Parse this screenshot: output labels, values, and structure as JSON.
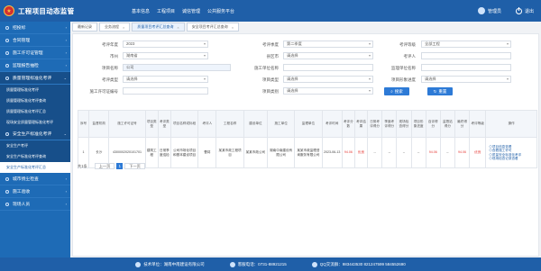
{
  "header": {
    "title": "工程项目动态监管",
    "nav": [
      "基本信息",
      "工程项目",
      "诚信管理",
      "公共服务平台"
    ],
    "user": "管理员",
    "exit": "退出"
  },
  "sidebar": {
    "items": [
      {
        "label": "招投标",
        "active": false
      },
      {
        "label": "合同管理",
        "active": false
      },
      {
        "label": "施工许可证管理",
        "active": false
      },
      {
        "label": "监理报告抽检",
        "active": false
      },
      {
        "label": "质量管理标准化考评",
        "active": false
      }
    ],
    "quality_subs": [
      "质量管理标准化考评",
      "质量管理标准化考评查询",
      "质量管理标准化考评汇总",
      "现场安全质量管理标准化考评"
    ],
    "safety_label": "安全生产标准化考评",
    "safety_subs": [
      "安全生产考评",
      "安全生产标准化考评查询",
      "安全生产标准化考评汇总"
    ],
    "bottom_items": [
      "城市扬尘检查",
      "施工验收",
      "现场人员"
    ]
  },
  "tabs": [
    {
      "label": "最新记录",
      "active": false
    },
    {
      "label": "业务流程",
      "active": false
    },
    {
      "label": "质量项目考评汇总查询",
      "active": true
    },
    {
      "label": "安全项目考评汇总查询",
      "active": false
    }
  ],
  "form": {
    "year_label": "考评年度",
    "year_value": "2023",
    "quarter_label": "考评季度",
    "quarter_value": "第二季度",
    "type_label": "考评等级",
    "type_value": "全部工程",
    "city_label": "市州",
    "city_value": "湖南省",
    "district_label": "县区市",
    "district_value": "请选择",
    "evaluator_label": "考评人",
    "evaluator_value": "",
    "project_label": "项目名称",
    "project_value": "公司",
    "builder_label": "施工单位名称",
    "builder_value": "",
    "supervisor_label": "监理单位名称",
    "supervisor_value": "",
    "kind_label": "考评类型",
    "kind_value": "请选择",
    "status_label": "项目类型",
    "status_value": "请选择",
    "progress_label": "项目形象进度",
    "progress_value": "请选择",
    "permit_label": "施工许可证编号",
    "permit_value": "",
    "result_label": "项目类别",
    "result_value": "请选择",
    "search_btn": "搜索",
    "reset_btn": "重置"
  },
  "table": {
    "headers": [
      "序号",
      "监督机构",
      "施工许可证号",
      "项目类型",
      "考评类型",
      "项目名称或标段",
      "考评人",
      "工程名称",
      "建设单位",
      "施工单位",
      "监理单位",
      "考评时间",
      "考评分数",
      "考评结果",
      "日常考评得分",
      "季度考评得分",
      "现场检查得分",
      "项目形象进度",
      "自评得分",
      "监督站得分",
      "最终得分",
      "考评等级",
      "操作"
    ],
    "rows": [
      {
        "no": "1",
        "agency": "长沙",
        "permit": "4300002020101701",
        "ptype": "建筑工程",
        "kind": "日常季度巡检",
        "project": "公司市场化项目和基本建设项目",
        "person": "曹将",
        "name": "某某市政工程项目",
        "builder": "某某市政公司",
        "constructor": "湖南中南建设有限公司",
        "supervisor": "某某市政监理咨询服务有限公司",
        "date": "2023-06-13",
        "score": "94.06",
        "result": "优良",
        "s1": "--",
        "s2": "--",
        "s3": "--",
        "s4": "--",
        "s5": "94.06",
        "s6": "--",
        "s7": "94.06",
        "grade": "优良",
        "ops": [
          "项目信息查看",
          "查看施工许可",
          "质量安全标准化考评",
          "现场检查记录查看"
        ]
      }
    ]
  },
  "pager": {
    "info": "共1条",
    "prev": "上一页",
    "page": "1",
    "next": "下一页"
  },
  "footer": {
    "org": "技术单位：湖南中南建设有限公司",
    "phone": "客服电话：0731-88921215",
    "qq": "QQ交流群：983443530 821247599 584552690"
  }
}
